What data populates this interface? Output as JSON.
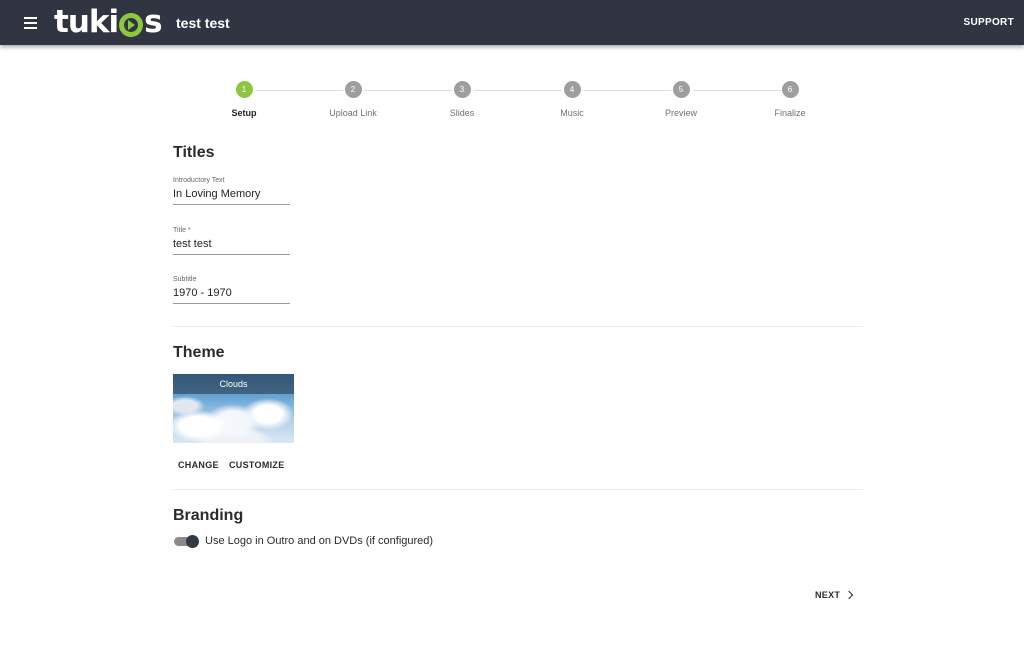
{
  "header": {
    "logo_text": "tukios",
    "logo_pre": "tuki",
    "logo_post": "s",
    "title": "test test",
    "support_label": "SUPPORT"
  },
  "stepper": {
    "steps": [
      {
        "number": "1",
        "label": "Setup",
        "active": true
      },
      {
        "number": "2",
        "label": "Upload Link",
        "active": false
      },
      {
        "number": "3",
        "label": "Slides",
        "active": false
      },
      {
        "number": "4",
        "label": "Music",
        "active": false
      },
      {
        "number": "5",
        "label": "Preview",
        "active": false
      },
      {
        "number": "6",
        "label": "Finalize",
        "active": false
      }
    ]
  },
  "titles": {
    "heading": "Titles",
    "intro": {
      "label": "Introductory Text",
      "value": "In Loving Memory"
    },
    "title": {
      "label": "Title *",
      "value": "test test"
    },
    "subtitle": {
      "label": "Subtitle",
      "value": "1970 - 1970"
    }
  },
  "theme": {
    "heading": "Theme",
    "name": "Clouds",
    "change_label": "CHANGE",
    "customize_label": "CUSTOMIZE"
  },
  "branding": {
    "heading": "Branding",
    "toggle_label": "Use Logo in Outro and on DVDs (if configured)",
    "toggle_on": true
  },
  "footer": {
    "next_label": "NEXT"
  },
  "colors": {
    "appbar": "#303541",
    "accent": "#8dc63f",
    "inactive_step": "#9e9e9e"
  },
  "icons": {
    "menu": "menu-icon",
    "next": "chevron-right-icon"
  }
}
